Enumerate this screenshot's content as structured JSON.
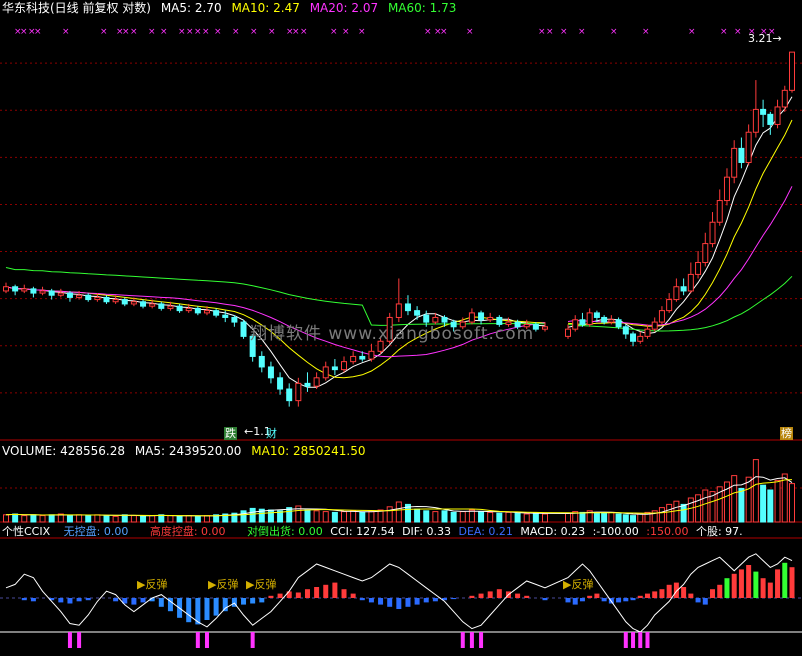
{
  "header": {
    "title": "华东科技(日线 前复权 对数)",
    "ma5": "MA5: 2.70",
    "ma10": "MA10: 2.47",
    "ma20": "MA20: 2.07",
    "ma60": "MA60: 1.73"
  },
  "volume_header": {
    "volume": "VOLUME: 428556.28",
    "ma5": "MA5: 2439520.00",
    "ma10": "MA10: 2850241.50"
  },
  "ccix_header": {
    "name": "个性CCIX",
    "no_control": "无控盘: 0.00",
    "high_control": "高度控盘: 0.00",
    "sell_signal": "对倒出货: 0.00",
    "cci": "CCI: 127.54",
    "dif": "DIF: 0.33",
    "dea": "DEA: 0.21",
    "macd": "MACD: 0.23",
    "neg100": ":-100.00",
    "pos150": ":150.00",
    "stock": "个股: 97."
  },
  "watermark": "翔博软件 www.xiangbosoft.com",
  "markers": {
    "die": "跌",
    "low_price": "1.1",
    "cai": "财",
    "bang": "榜",
    "high_price": "3.21",
    "rebound1": "反弹",
    "rebound2": "反弹",
    "rebound3": "反弹",
    "rebound4": "反弹"
  },
  "colors": {
    "up": "#ff3b3b",
    "down": "#54ffff",
    "ma5": "#ffffff",
    "ma10": "#ffff00",
    "ma20": "#ff33ff",
    "ma60": "#33ff33",
    "grid": "#8b0000"
  },
  "chart_data": {
    "type": "candlestick",
    "price_axis": "log",
    "latest_high": 3.21,
    "period_low": 1.1,
    "candles": [
      [
        1.56,
        1.58,
        1.6,
        1.55
      ],
      [
        1.58,
        1.56,
        1.59,
        1.54
      ],
      [
        1.56,
        1.57,
        1.59,
        1.55
      ],
      [
        1.57,
        1.55,
        1.58,
        1.53
      ],
      [
        1.55,
        1.56,
        1.58,
        1.54
      ],
      [
        1.56,
        1.54,
        1.57,
        1.52
      ],
      [
        1.54,
        1.55,
        1.57,
        1.53
      ],
      [
        1.55,
        1.53,
        1.56,
        1.51
      ],
      [
        1.53,
        1.54,
        1.56,
        1.52
      ],
      [
        1.54,
        1.52,
        1.55,
        1.51
      ],
      [
        1.52,
        1.53,
        1.55,
        1.51
      ],
      [
        1.53,
        1.51,
        1.54,
        1.5
      ],
      [
        1.51,
        1.52,
        1.54,
        1.5
      ],
      [
        1.52,
        1.5,
        1.53,
        1.49
      ],
      [
        1.5,
        1.51,
        1.53,
        1.49
      ],
      [
        1.51,
        1.49,
        1.52,
        1.48
      ],
      [
        1.49,
        1.5,
        1.52,
        1.48
      ],
      [
        1.5,
        1.48,
        1.51,
        1.47
      ],
      [
        1.48,
        1.49,
        1.51,
        1.47
      ],
      [
        1.49,
        1.47,
        1.5,
        1.46
      ],
      [
        1.47,
        1.48,
        1.5,
        1.46
      ],
      [
        1.48,
        1.46,
        1.49,
        1.45
      ],
      [
        1.46,
        1.47,
        1.49,
        1.45
      ],
      [
        1.47,
        1.45,
        1.48,
        1.44
      ],
      [
        1.45,
        1.44,
        1.47,
        1.42
      ],
      [
        1.44,
        1.42,
        1.45,
        1.4
      ],
      [
        1.42,
        1.36,
        1.43,
        1.35
      ],
      [
        1.36,
        1.28,
        1.37,
        1.26
      ],
      [
        1.28,
        1.24,
        1.3,
        1.22
      ],
      [
        1.24,
        1.2,
        1.26,
        1.18
      ],
      [
        1.2,
        1.16,
        1.22,
        1.14
      ],
      [
        1.16,
        1.12,
        1.18,
        1.1
      ],
      [
        1.12,
        1.18,
        1.2,
        1.1
      ],
      [
        1.18,
        1.17,
        1.22,
        1.15
      ],
      [
        1.17,
        1.2,
        1.22,
        1.16
      ],
      [
        1.2,
        1.24,
        1.26,
        1.19
      ],
      [
        1.24,
        1.23,
        1.27,
        1.21
      ],
      [
        1.23,
        1.26,
        1.28,
        1.22
      ],
      [
        1.26,
        1.28,
        1.3,
        1.25
      ],
      [
        1.28,
        1.27,
        1.3,
        1.26
      ],
      [
        1.27,
        1.3,
        1.33,
        1.26
      ],
      [
        1.3,
        1.34,
        1.36,
        1.29
      ],
      [
        1.34,
        1.44,
        1.46,
        1.33
      ],
      [
        1.44,
        1.5,
        1.62,
        1.42
      ],
      [
        1.5,
        1.47,
        1.54,
        1.45
      ],
      [
        1.47,
        1.45,
        1.49,
        1.43
      ],
      [
        1.45,
        1.42,
        1.47,
        1.4
      ],
      [
        1.42,
        1.44,
        1.46,
        1.41
      ],
      [
        1.44,
        1.42,
        1.45,
        1.4
      ],
      [
        1.42,
        1.4,
        1.43,
        1.38
      ],
      [
        1.4,
        1.42,
        1.44,
        1.39
      ],
      [
        1.42,
        1.46,
        1.48,
        1.41
      ],
      [
        1.46,
        1.43,
        1.47,
        1.41
      ],
      [
        1.43,
        1.44,
        1.46,
        1.42
      ],
      [
        1.44,
        1.41,
        1.45,
        1.4
      ],
      [
        1.41,
        1.42,
        1.44,
        1.4
      ],
      [
        1.42,
        1.4,
        1.43,
        1.39
      ],
      [
        1.4,
        1.41,
        1.43,
        1.39
      ],
      [
        1.41,
        1.39,
        1.42,
        1.38
      ],
      [
        1.39,
        1.4,
        1.42,
        1.38
      ],
      [
        1.36,
        1.39,
        1.41,
        1.35
      ],
      [
        1.39,
        1.43,
        1.45,
        1.38
      ],
      [
        1.43,
        1.41,
        1.46,
        1.4
      ],
      [
        1.41,
        1.46,
        1.48,
        1.4
      ],
      [
        1.46,
        1.44,
        1.47,
        1.42
      ],
      [
        1.44,
        1.42,
        1.45,
        1.41
      ],
      [
        1.42,
        1.43,
        1.45,
        1.41
      ],
      [
        1.43,
        1.4,
        1.44,
        1.39
      ],
      [
        1.4,
        1.37,
        1.41,
        1.35
      ],
      [
        1.37,
        1.34,
        1.38,
        1.32
      ],
      [
        1.34,
        1.36,
        1.38,
        1.33
      ],
      [
        1.36,
        1.39,
        1.41,
        1.35
      ],
      [
        1.39,
        1.42,
        1.44,
        1.38
      ],
      [
        1.42,
        1.47,
        1.49,
        1.41
      ],
      [
        1.47,
        1.52,
        1.55,
        1.46
      ],
      [
        1.52,
        1.58,
        1.62,
        1.51
      ],
      [
        1.58,
        1.56,
        1.62,
        1.54
      ],
      [
        1.56,
        1.64,
        1.7,
        1.55
      ],
      [
        1.64,
        1.7,
        1.76,
        1.62
      ],
      [
        1.7,
        1.8,
        1.86,
        1.68
      ],
      [
        1.8,
        1.92,
        1.98,
        1.78
      ],
      [
        1.92,
        2.05,
        2.12,
        1.9
      ],
      [
        2.05,
        2.2,
        2.26,
        2.02
      ],
      [
        2.2,
        2.4,
        2.46,
        2.16
      ],
      [
        2.4,
        2.3,
        2.48,
        2.26
      ],
      [
        2.3,
        2.52,
        2.58,
        2.28
      ],
      [
        2.52,
        2.7,
        2.95,
        2.48
      ],
      [
        2.7,
        2.66,
        2.78,
        2.56
      ],
      [
        2.66,
        2.58,
        2.68,
        2.5
      ],
      [
        2.58,
        2.72,
        2.78,
        2.55
      ],
      [
        2.72,
        2.86,
        2.9,
        2.68
      ],
      [
        2.86,
        3.21,
        3.21,
        2.84
      ]
    ],
    "gap_after_index": 59,
    "ma_series": [
      "ma5",
      "ma10",
      "ma20",
      "ma60"
    ],
    "volume": [
      9,
      10,
      8,
      9,
      8,
      9,
      10,
      8,
      9,
      8,
      9,
      8,
      7,
      9,
      8,
      7,
      8,
      9,
      8,
      7,
      8,
      7,
      8,
      9,
      10,
      11,
      14,
      17,
      16,
      15,
      14,
      18,
      20,
      15,
      14,
      13,
      12,
      13,
      14,
      12,
      13,
      15,
      19,
      25,
      22,
      16,
      14,
      13,
      14,
      12,
      13,
      15,
      13,
      12,
      11,
      12,
      11,
      10,
      11,
      10,
      11,
      13,
      12,
      14,
      12,
      11,
      12,
      10,
      9,
      8,
      10,
      12,
      14,
      18,
      22,
      26,
      22,
      30,
      34,
      40,
      38,
      44,
      50,
      58,
      42,
      56,
      78,
      46,
      40,
      52,
      60,
      48
    ],
    "oscillator": {
      "cci_line": [
        60,
        80,
        140,
        120,
        40,
        -20,
        -80,
        -150,
        -160,
        -100,
        -20,
        40,
        20,
        -40,
        -80,
        -40,
        0,
        20,
        -20,
        -60,
        -100,
        -140,
        -170,
        -120,
        -60,
        -30,
        -100,
        -160,
        -120,
        -80,
        -20,
        40,
        120,
        160,
        200,
        180,
        160,
        140,
        120,
        100,
        120,
        160,
        200,
        180,
        140,
        100,
        60,
        20,
        -20,
        -80,
        -140,
        -180,
        -160,
        -100,
        -40,
        20,
        60,
        100,
        80,
        60,
        120,
        160,
        200,
        160,
        100,
        40,
        -20,
        -80,
        -140,
        -180,
        -200,
        -160,
        -100,
        -60,
        -20,
        40,
        80,
        140,
        180,
        200,
        220,
        240,
        200,
        160,
        200,
        240,
        260,
        220,
        180,
        200,
        240,
        220
      ],
      "histogram": [
        0,
        0,
        -2,
        -3,
        0,
        -2,
        -4,
        -5,
        -3,
        -2,
        0,
        0,
        -3,
        -5,
        -6,
        -4,
        -3,
        -8,
        -12,
        -18,
        -22,
        -24,
        -20,
        -16,
        -12,
        -8,
        -6,
        -5,
        -4,
        2,
        4,
        6,
        5,
        8,
        10,
        12,
        14,
        8,
        4,
        -2,
        -4,
        -6,
        -8,
        -10,
        -8,
        -6,
        -4,
        -3,
        -2,
        -1,
        0,
        2,
        4,
        6,
        8,
        6,
        4,
        2,
        0,
        -2,
        -4,
        -6,
        -3,
        2,
        4,
        -3,
        -5,
        -4,
        -3,
        -2,
        2,
        4,
        6,
        8,
        12,
        14,
        10,
        4,
        -4,
        -6,
        8,
        12,
        18,
        22,
        26,
        30,
        24,
        18,
        14,
        26,
        32,
        28
      ]
    }
  }
}
